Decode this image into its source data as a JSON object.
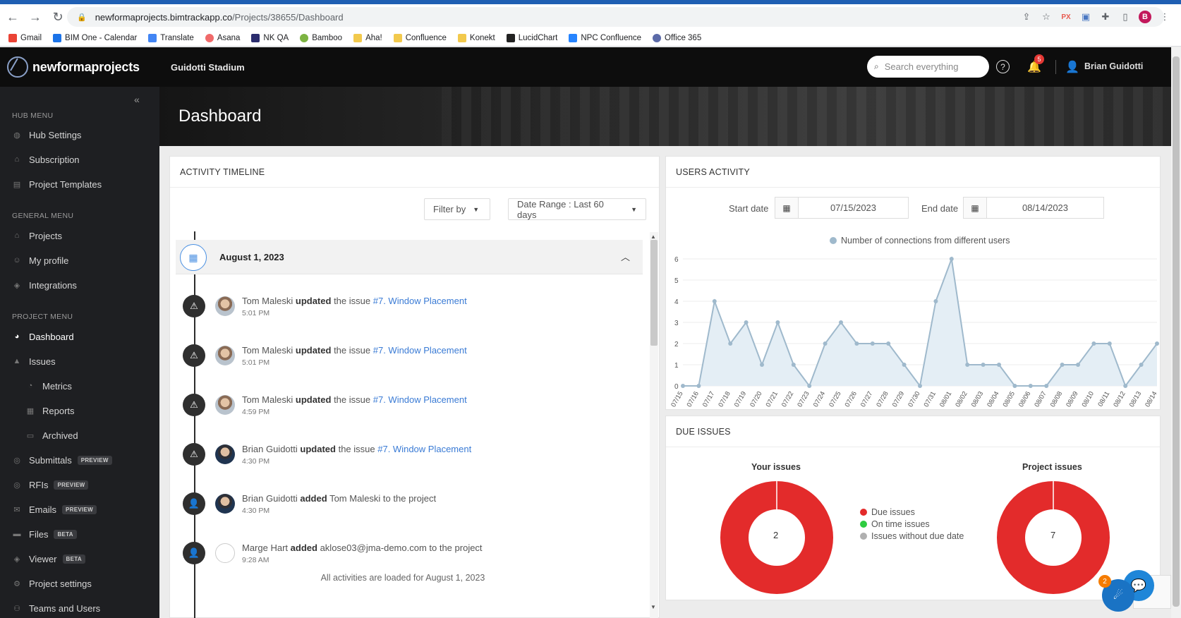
{
  "browser": {
    "url_host": "newformaprojects.bimtrackapp.co",
    "url_path": "/Projects/38655/Dashboard",
    "profile_initial": "B",
    "bookmarks": [
      "Gmail",
      "BIM One - Calendar",
      "Translate",
      "Asana",
      "NK QA",
      "Bamboo",
      "Aha!",
      "Confluence",
      "Konekt",
      "LucidChart",
      "NPC Confluence",
      "Office 365"
    ]
  },
  "header": {
    "logo": "newformaprojects",
    "project": "Guidotti Stadium",
    "search_placeholder": "Search everything",
    "notifications": "5",
    "user": "Brian Guidotti"
  },
  "sidebar": {
    "hub_menu": "HUB MENU",
    "hub_items": [
      "Hub Settings",
      "Subscription",
      "Project Templates"
    ],
    "general_menu": "GENERAL MENU",
    "general_items": [
      "Projects",
      "My profile",
      "Integrations"
    ],
    "project_menu": "PROJECT MENU",
    "project_items": {
      "dashboard": "Dashboard",
      "issues": "Issues",
      "metrics": "Metrics",
      "reports": "Reports",
      "archived": "Archived",
      "submittals": "Submittals",
      "rfis": "RFIs",
      "emails": "Emails",
      "files": "Files",
      "viewer": "Viewer",
      "project_settings": "Project settings",
      "teams": "Teams and Users"
    },
    "tags": {
      "preview": "PREVIEW",
      "beta": "BETA"
    }
  },
  "page": {
    "title": "Dashboard"
  },
  "timeline": {
    "title": "ACTIVITY TIMELINE",
    "filter": "Filter by",
    "date_range": "Date Range : Last 60 days",
    "day": "August 1, 2023",
    "entries": [
      {
        "actor": "Tom Maleski",
        "verb": "updated",
        "mid": "the issue",
        "link": "#7. Window Placement",
        "time": "5:01 PM"
      },
      {
        "actor": "Tom Maleski",
        "verb": "updated",
        "mid": "the issue",
        "link": "#7. Window Placement",
        "time": "5:01 PM"
      },
      {
        "actor": "Tom Maleski",
        "verb": "updated",
        "mid": "the issue",
        "link": "#7. Window Placement",
        "time": "4:59 PM"
      },
      {
        "actor": "Brian Guidotti",
        "verb": "updated",
        "mid": "the issue",
        "link": "#7. Window Placement",
        "time": "4:30 PM"
      },
      {
        "actor": "Brian Guidotti",
        "verb": "added",
        "mid": "Tom Maleski to the project",
        "link": "",
        "time": "4:30 PM"
      },
      {
        "actor": "Marge Hart",
        "verb": "added",
        "mid": "aklose03@jma-demo.com to the project",
        "link": "",
        "time": "9:28 AM"
      }
    ],
    "footer": "All activities are loaded for August 1, 2023"
  },
  "users_activity": {
    "title": "USERS ACTIVITY",
    "start_label": "Start date",
    "start_value": "07/15/2023",
    "end_label": "End date",
    "end_value": "08/14/2023"
  },
  "chart_data": {
    "type": "area",
    "series": [
      {
        "name": "Number of connections from different users",
        "values": [
          0,
          0,
          4,
          2,
          3,
          1,
          3,
          1,
          0,
          2,
          3,
          2,
          2,
          2,
          1,
          0,
          4,
          6,
          1,
          1,
          1,
          0,
          0,
          0,
          1,
          1,
          2,
          2,
          0,
          1,
          2
        ]
      }
    ],
    "x": [
      "07/15",
      "07/16",
      "07/17",
      "07/18",
      "07/19",
      "07/20",
      "07/21",
      "07/22",
      "07/23",
      "07/24",
      "07/25",
      "07/26",
      "07/27",
      "07/28",
      "07/29",
      "07/30",
      "07/31",
      "08/01",
      "08/02",
      "08/03",
      "08/04",
      "08/05",
      "08/06",
      "08/07",
      "08/08",
      "08/09",
      "08/10",
      "08/11",
      "08/12",
      "08/13",
      "08/14"
    ],
    "ylim": [
      0,
      6
    ],
    "yticks": [
      "0",
      "1",
      "2",
      "3",
      "4",
      "5",
      "6"
    ],
    "legend": "top",
    "grid": true,
    "color": "#9fb9cc"
  },
  "due_issues": {
    "title": "DUE ISSUES",
    "your_title": "Your issues",
    "your_count": "2",
    "project_title": "Project issues",
    "project_count": "7",
    "legend": [
      {
        "label": "Due issues",
        "color": "#e32b2b"
      },
      {
        "label": "On time issues",
        "color": "#2ecc40"
      },
      {
        "label": "Issues without due date",
        "color": "#b0b0b0"
      }
    ]
  },
  "widgets": {
    "launcher_badge": "2"
  }
}
